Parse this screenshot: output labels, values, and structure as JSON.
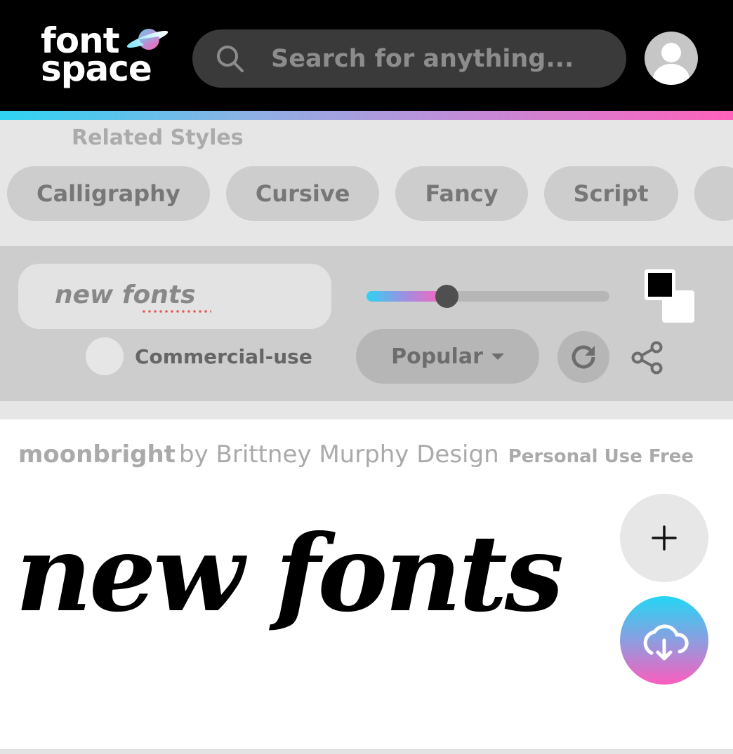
{
  "header": {
    "logo_line1": "font",
    "logo_line2": "space",
    "search_placeholder": "Search for anything...",
    "search_icon": "search-icon",
    "avatar_icon": "user-icon"
  },
  "related_styles": {
    "title": "Related Styles",
    "chips": [
      {
        "label": "Calligraphy"
      },
      {
        "label": "Cursive"
      },
      {
        "label": "Fancy"
      },
      {
        "label": "Script"
      },
      {
        "label": ""
      }
    ]
  },
  "controls": {
    "preview_text": "new fonts",
    "size_slider_fraction": 0.33,
    "commercial_use_label": "Commercial-use",
    "commercial_use_checked": false,
    "sort_label": "Popular",
    "refresh_icon": "refresh-icon",
    "share_icon": "share-icon",
    "color_swap_icon": "color-swap-icon"
  },
  "font_card": {
    "name": "moonbright",
    "by_text": "by Brittney Murphy Design",
    "license": "Personal Use Free",
    "preview_text": "new fonts",
    "add_icon": "plus-icon",
    "download_icon": "cloud-download-icon"
  },
  "colors": {
    "accent_cyan": "#2fd3f2",
    "accent_pink": "#ff62bb",
    "header_bg": "#000000"
  }
}
